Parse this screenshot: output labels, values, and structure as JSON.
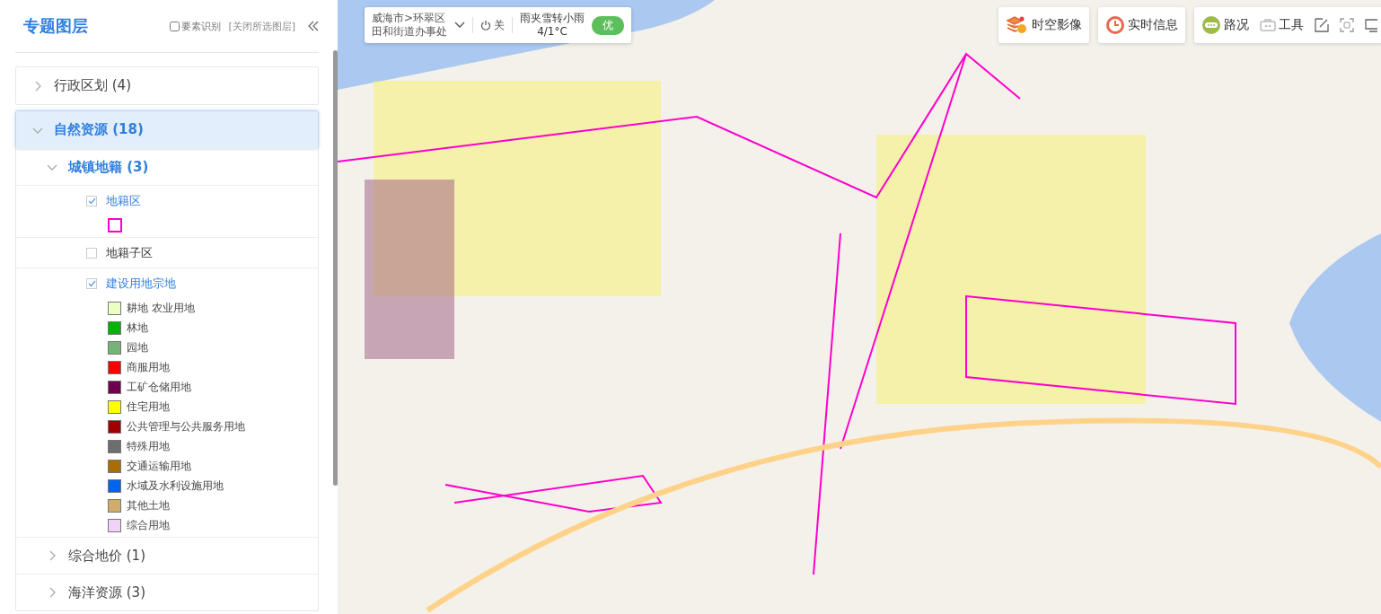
{
  "panel": {
    "title": "专题图层",
    "identify": {
      "label": "要素识别",
      "checked": false
    },
    "close_all": "[关闭所选图层]"
  },
  "groups": [
    {
      "label": "行政区划 (4)",
      "expanded": false,
      "selected": false
    },
    {
      "label": "自然资源 (18)",
      "expanded": true,
      "selected": true,
      "children": [
        {
          "label": "城镇地籍 (3)",
          "expanded": true,
          "layers": [
            {
              "label": "地籍区",
              "checked": true,
              "legend": [
                {
                  "kind": "outline",
                  "color": "#ff00cc"
                }
              ]
            },
            {
              "label": "地籍子区",
              "checked": false
            },
            {
              "label": "建设用地宗地",
              "checked": true,
              "legend": [
                {
                  "kind": "fill",
                  "label": "耕地 农业用地",
                  "color": "#eaffc0"
                },
                {
                  "kind": "fill",
                  "label": "林地",
                  "color": "#00b400"
                },
                {
                  "kind": "fill",
                  "label": "园地",
                  "color": "#74b476"
                },
                {
                  "kind": "fill",
                  "label": "商服用地",
                  "color": "#ff0000"
                },
                {
                  "kind": "fill",
                  "label": "工矿仓储用地",
                  "color": "#6e0050"
                },
                {
                  "kind": "fill",
                  "label": "住宅用地",
                  "color": "#ffff00"
                },
                {
                  "kind": "fill",
                  "label": "公共管理与公共服务用地",
                  "color": "#a00000"
                },
                {
                  "kind": "fill",
                  "label": "特殊用地",
                  "color": "#6e6e6e"
                },
                {
                  "kind": "fill",
                  "label": "交通运输用地",
                  "color": "#aa6e00"
                },
                {
                  "kind": "fill",
                  "label": "水域及水利设施用地",
                  "color": "#0064f0"
                },
                {
                  "kind": "fill",
                  "label": "其他土地",
                  "color": "#d2aa6e"
                },
                {
                  "kind": "fill",
                  "label": "综合用地",
                  "color": "#f0d2fa"
                }
              ]
            }
          ]
        },
        {
          "label": "综合地价 (1)",
          "expanded": false
        },
        {
          "label": "海洋资源 (3)",
          "expanded": false
        }
      ]
    }
  ],
  "location": {
    "line1": "威海市>环翠区",
    "line2": "田和街道办事处",
    "power": "关",
    "weather": "雨夹雪转小雨",
    "temperature": "4/1°C",
    "air_quality": "优"
  },
  "toolbar": [
    {
      "kind": "layer",
      "label": "时空影像"
    },
    {
      "kind": "clock",
      "label": "实时信息"
    },
    {
      "kind": "traffic",
      "label": "路况"
    },
    {
      "kind": "tools",
      "label": "工具"
    },
    {
      "kind": "edit"
    },
    {
      "kind": "screenshot"
    },
    {
      "kind": "monitor"
    }
  ]
}
